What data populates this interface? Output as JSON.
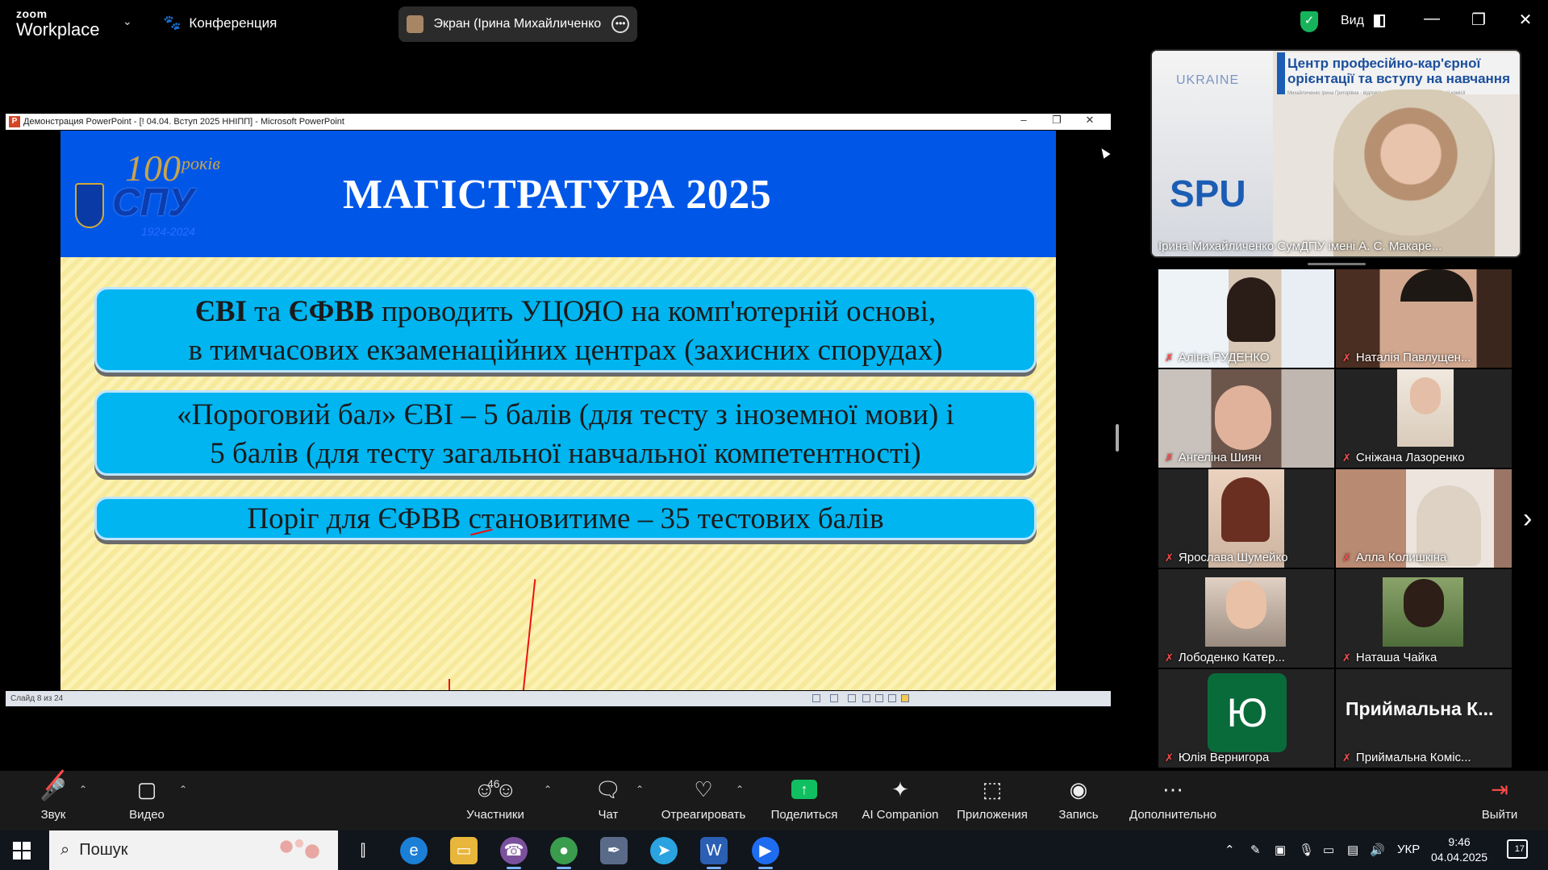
{
  "window": {
    "brand_top": "zoom",
    "brand_bottom": "Workplace",
    "conference_label": "Конференция",
    "screen_share_label": "Экран (Ірина Михайличенко СумДПУ імені А. С. Макаренка)",
    "view_label": "Вид"
  },
  "powerpoint": {
    "title_bar": "Демонстрация PowerPoint - [! 04.04. Вступ 2025 ННІПП] - Microsoft PowerPoint",
    "status_slide": "Слайд 8 из 24",
    "slide": {
      "logo_number": "100",
      "logo_word": "років",
      "logo_abbr": "СПУ",
      "logo_years": "1924-2024",
      "title": "МАГІСТРАТУРА 2025",
      "box1_bold1": "ЄВІ",
      "box1_mid": " та ",
      "box1_bold2": "ЄФВВ",
      "box1_rest": " проводить УЦОЯО на комп'ютерній основі,",
      "box1_line2": "в тимчасових екзаменаційних центрах (захисних спорудах)",
      "box2_line1": "«Пороговий бал» ЄВІ – 5 балів (для тесту з іноземної мови) і",
      "box2_line2": "5 балів (для тесту загальної навчальної компетентності)",
      "box3_line": "Поріг для ЄФВВ становитиме – 35 тестових балів"
    }
  },
  "speaker": {
    "ukraine": "UKRAINE",
    "spu": "SPU",
    "banner_title": "Центр професійно-кар'єрної орієнтації та вступу на навчання",
    "banner_sub": "Михайличенко Ірина Григорівна - відповідальний секретар Приймальної комісії",
    "name": "Ірина Михайличенко СумДПУ імені А. С. Макаре..."
  },
  "participants": [
    {
      "name": "Аліна РУДЕНКО"
    },
    {
      "name": "Наталія Павлущен..."
    },
    {
      "name": "Ангеліна Шиян"
    },
    {
      "name": "Сніжана Лазоренко"
    },
    {
      "name": "Ярослава Шумейко"
    },
    {
      "name": "Алла Колишкіна"
    },
    {
      "name": "Лободенко Катер..."
    },
    {
      "name": "Наташа Чайка"
    },
    {
      "name": "Юлія Вернигора",
      "initial": "Ю"
    },
    {
      "name": "Приймальна Коміс...",
      "display": "Приймальна К..."
    }
  ],
  "toolbar": {
    "audio": "Звук",
    "video": "Видео",
    "participants": "Участники",
    "participants_count": "46",
    "chat": "Чат",
    "react": "Отреагировать",
    "share": "Поделиться",
    "ai": "AI Companion",
    "apps": "Приложения",
    "record": "Запись",
    "more": "Дополнительно",
    "leave": "Выйти"
  },
  "taskbar": {
    "search_placeholder": "Пошук",
    "lang": "УКР",
    "time": "9:46",
    "date": "04.04.2025",
    "notifications": "17"
  },
  "colors": {
    "slide_header": "#0057e7",
    "slide_box": "#00b5f0",
    "share_green": "#10c060",
    "muted_red": "#ff4b4b"
  }
}
